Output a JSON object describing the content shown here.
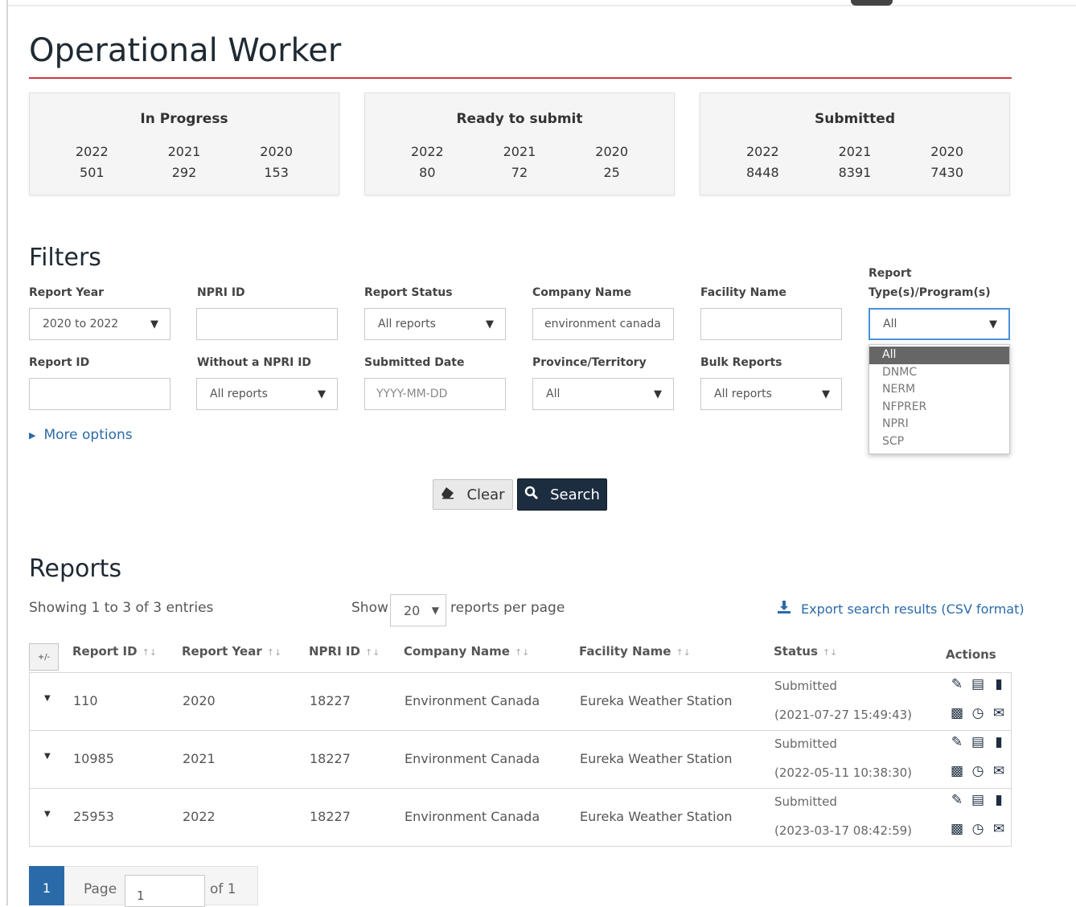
{
  "page_title": "Operational Worker",
  "summary_cards": [
    {
      "title": "In Progress",
      "years": [
        {
          "year": "2022",
          "count": "501"
        },
        {
          "year": "2021",
          "count": "292"
        },
        {
          "year": "2020",
          "count": "153"
        }
      ]
    },
    {
      "title": "Ready to submit",
      "years": [
        {
          "year": "2022",
          "count": "80"
        },
        {
          "year": "2021",
          "count": "72"
        },
        {
          "year": "2020",
          "count": "25"
        }
      ]
    },
    {
      "title": "Submitted",
      "years": [
        {
          "year": "2022",
          "count": "8448"
        },
        {
          "year": "2021",
          "count": "8391"
        },
        {
          "year": "2020",
          "count": "7430"
        }
      ]
    }
  ],
  "filters": {
    "heading": "Filters",
    "report_year": {
      "label": "Report Year",
      "value": "2020 to 2022"
    },
    "npri_id": {
      "label": "NPRI ID",
      "value": ""
    },
    "report_status": {
      "label": "Report Status",
      "value": "All reports"
    },
    "company_name": {
      "label": "Company Name",
      "value": "environment canada"
    },
    "facility_name": {
      "label": "Facility Name",
      "value": ""
    },
    "report_type": {
      "label_line1": "Report",
      "label_line2": "Type(s)/Program(s)",
      "value": "All",
      "options": [
        "All",
        "DNMC",
        "NERM",
        "NFPRER",
        "NPRI",
        "SCP"
      ]
    },
    "report_id": {
      "label": "Report ID",
      "value": ""
    },
    "without_npri": {
      "label": "Without a NPRI ID",
      "value": "All reports"
    },
    "submitted_date": {
      "label": "Submitted Date",
      "placeholder": "YYYY-MM-DD"
    },
    "province": {
      "label": "Province/Territory",
      "value": "All"
    },
    "bulk_reports": {
      "label": "Bulk Reports",
      "value": "All reports"
    },
    "more_options": "More options",
    "clear_label": "Clear",
    "search_label": "Search"
  },
  "reports": {
    "heading": "Reports",
    "showing": "Showing 1 to 3 of 3 entries",
    "show_label": "Show",
    "per_page_value": "20",
    "per_page_label": "reports per page",
    "export_label": "Export search results (CSV format)",
    "toggle_label": "+/-",
    "columns": [
      "Report ID",
      "Report Year",
      "NPRI ID",
      "Company Name",
      "Facility Name",
      "Status",
      "Actions"
    ],
    "rows": [
      {
        "report_id": "110",
        "year": "2020",
        "npri_id": "18227",
        "company": "Environment Canada",
        "facility": "Eureka Weather Station",
        "status": "Submitted",
        "status_date": "(2021-07-27 15:49:43)"
      },
      {
        "report_id": "10985",
        "year": "2021",
        "npri_id": "18227",
        "company": "Environment Canada",
        "facility": "Eureka Weather Station",
        "status": "Submitted",
        "status_date": "(2022-05-11 10:38:30)"
      },
      {
        "report_id": "25953",
        "year": "2022",
        "npri_id": "18227",
        "company": "Environment Canada",
        "facility": "Eureka Weather Station",
        "status": "Submitted",
        "status_date": "(2023-03-17 08:42:59)"
      }
    ]
  },
  "pagination": {
    "current": "1",
    "page_label": "Page",
    "page_input": "1",
    "of_label": "of 1"
  },
  "colors": {
    "accent_red": "#cc3a45",
    "primary_dark": "#1d2d40",
    "link_blue": "#2b6aa8"
  }
}
